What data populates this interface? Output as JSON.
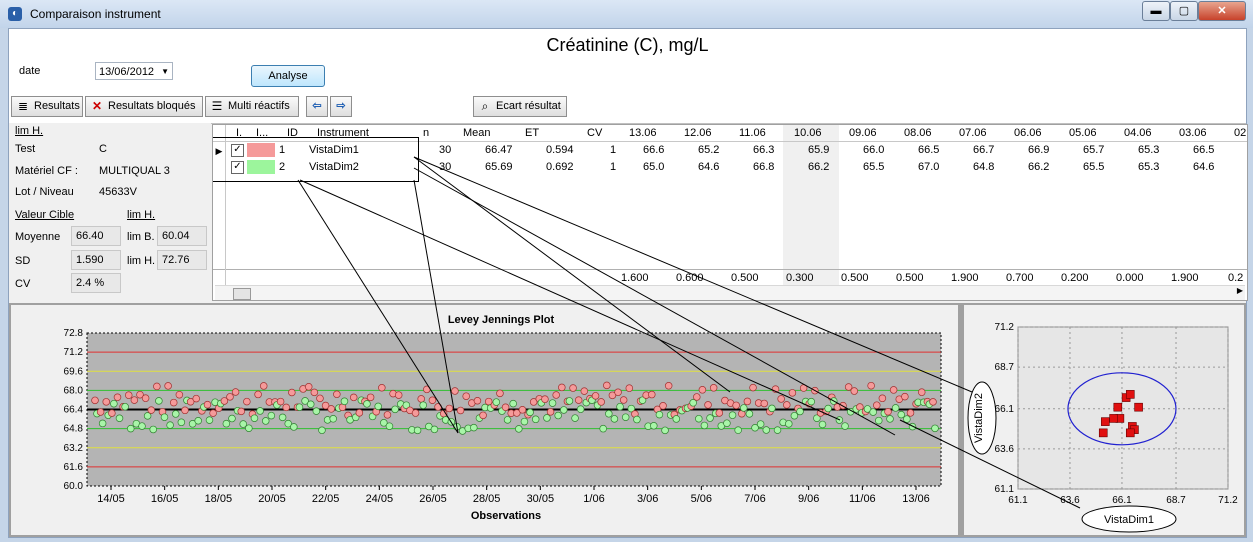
{
  "window": {
    "title": "Comparaison instrument",
    "min_label": "▬",
    "max_label": "▢",
    "close_label": "✕"
  },
  "header": {
    "title": "Créatinine (C), mg/L",
    "date_label": "date",
    "date_value": "13/06/2012",
    "analyse_label": "Analyse"
  },
  "toolbar": {
    "resultats_label": "Resultats",
    "bloques_label": "Resultats bloqués",
    "multi_label": "Multi réactifs",
    "ecart_label": "Ecart résultat"
  },
  "left": {
    "lim_header": "lim H.",
    "test_label": "Test",
    "test_value": "C",
    "materiel_label": "Matériel CF :",
    "materiel_value": "MULTIQUAL 3",
    "lot_label": "Lot / Niveau",
    "lot_value": "45633V",
    "valeur_cible_label": "Valeur Cible",
    "lim_h_label2": "lim H.",
    "moyenne_label": "Moyenne",
    "moyenne_value": "66.40",
    "lim_b_label": "lim B.",
    "lim_b_value": "60.04",
    "sd_label": "SD",
    "sd_value": "1.590",
    "lim_h_label": "lim H.",
    "lim_h_value": "72.76",
    "cv_label": "CV",
    "cv_value": "2.4 %"
  },
  "grid": {
    "columns": [
      "I.",
      "I...",
      "ID",
      "Instrument",
      "n",
      "Mean",
      "ET",
      "CV",
      "13.06",
      "12.06",
      "11.06",
      "10.06",
      "09.06",
      "08.06",
      "07.06",
      "06.06",
      "05.06",
      "04.06",
      "03.06",
      "02"
    ],
    "rows": [
      {
        "id": "1",
        "instrument": "VistaDim1",
        "color": "#f59a9a",
        "n": "30",
        "mean": "66.47",
        "et": "0.594",
        "cv": "1",
        "vals": [
          "66.6",
          "65.2",
          "66.3",
          "65.9",
          "66.0",
          "66.5",
          "66.7",
          "66.9",
          "65.7",
          "65.3",
          "66.5",
          ""
        ]
      },
      {
        "id": "2",
        "instrument": "VistaDim2",
        "color": "#9cf59c",
        "n": "30",
        "mean": "65.69",
        "et": "0.692",
        "cv": "1",
        "vals": [
          "65.0",
          "64.6",
          "66.8",
          "66.2",
          "65.5",
          "67.0",
          "64.8",
          "66.2",
          "65.5",
          "65.3",
          "64.6",
          ""
        ]
      }
    ],
    "footer": [
      "1.600",
      "0.600",
      "0.500",
      "0.300",
      "0.500",
      "0.500",
      "1.900",
      "0.700",
      "0.200",
      "0.000",
      "1.900",
      "0.2"
    ]
  },
  "lj_plot": {
    "title": "Levey Jennings Plot",
    "xlabel": "Observations",
    "yticks": [
      "72.8",
      "71.2",
      "69.6",
      "68.0",
      "66.4",
      "64.8",
      "63.2",
      "61.6",
      "60.0"
    ],
    "xticks": [
      "14/05",
      "16/05",
      "18/05",
      "20/05",
      "22/05",
      "24/05",
      "26/05",
      "28/05",
      "30/05",
      "1/06",
      "3/06",
      "5/06",
      "7/06",
      "9/06",
      "11/06",
      "13/06"
    ]
  },
  "chart_data": {
    "type": "scatter",
    "title": "",
    "xlabel": "VistaDim1",
    "ylabel": "VistaDim2",
    "xlim": [
      61.1,
      71.2
    ],
    "ylim": [
      61.1,
      71.2
    ],
    "xticks": [
      "61.1",
      "63.6",
      "66.1",
      "68.7",
      "71.2"
    ],
    "yticks": [
      "71.2",
      "68.7",
      "66.1",
      "63.6",
      "61.1"
    ],
    "x": [
      66.6,
      65.2,
      66.3,
      65.9,
      66.0,
      66.5,
      66.7,
      66.9,
      65.7,
      65.3,
      66.5
    ],
    "y": [
      65.0,
      64.6,
      66.8,
      66.2,
      65.5,
      67.0,
      64.8,
      66.2,
      65.5,
      65.3,
      64.6
    ]
  }
}
